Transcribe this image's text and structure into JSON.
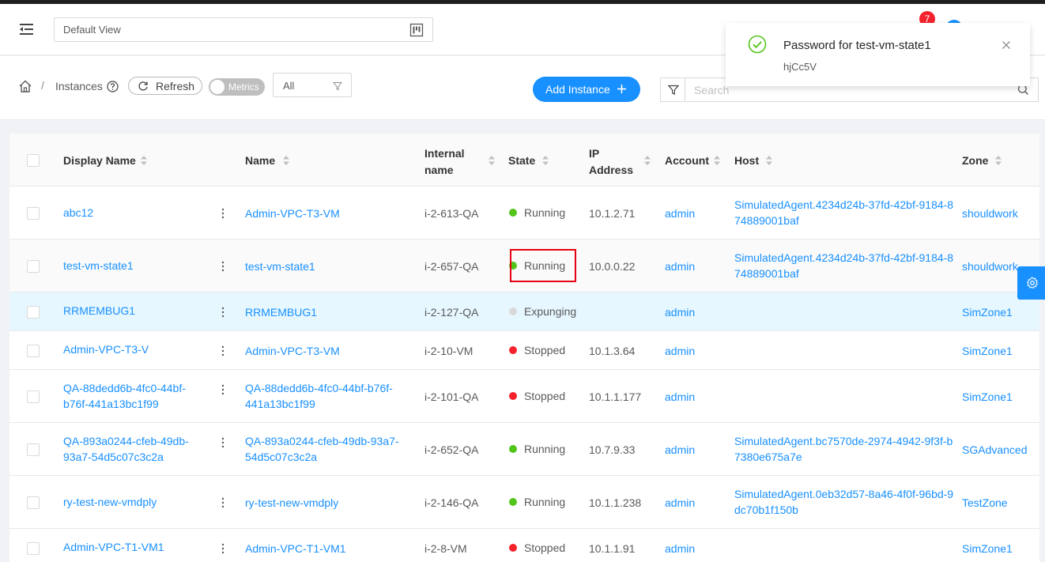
{
  "header": {
    "view_selector": "Default View",
    "notification_count": "7"
  },
  "breadcrumb": {
    "current": "Instances"
  },
  "toolbar": {
    "refresh_label": "Refresh",
    "metrics_label": "Metrics",
    "filter_value": "All",
    "add_label": "Add Instance",
    "search_placeholder": "Search"
  },
  "table": {
    "columns": [
      "Display Name",
      "Name",
      "Internal name",
      "State",
      "IP Address",
      "Account",
      "Host",
      "Zone"
    ],
    "rows": [
      {
        "display_name": "abc12",
        "name": "Admin-VPC-T3-VM",
        "internal": "i-2-613-QA",
        "state": "Running",
        "ip": "10.1.2.71",
        "account": "admin",
        "host": "SimulatedAgent.4234d24b-37fd-42bf-9184-874889001baf",
        "zone": "shouldwork"
      },
      {
        "display_name": "test-vm-state1",
        "name": "test-vm-state1",
        "internal": "i-2-657-QA",
        "state": "Running",
        "ip": "10.0.0.22",
        "account": "admin",
        "host": "SimulatedAgent.4234d24b-37fd-42bf-9184-874889001baf",
        "zone": "shouldwork"
      },
      {
        "display_name": "RRMEMBUG1",
        "name": "RRMEMBUG1",
        "internal": "i-2-127-QA",
        "state": "Expunging",
        "ip": "",
        "account": "admin",
        "host": "",
        "zone": "SimZone1"
      },
      {
        "display_name": "Admin-VPC-T3-V",
        "name": "Admin-VPC-T3-VM",
        "internal": "i-2-10-VM",
        "state": "Stopped",
        "ip": "10.1.3.64",
        "account": "admin",
        "host": "",
        "zone": "SimZone1"
      },
      {
        "display_name": "QA-88dedd6b-4fc0-44bf-b76f-441a13bc1f99",
        "name": "QA-88dedd6b-4fc0-44bf-b76f-441a13bc1f99",
        "internal": "i-2-101-QA",
        "state": "Stopped",
        "ip": "10.1.1.177",
        "account": "admin",
        "host": "",
        "zone": "SimZone1"
      },
      {
        "display_name": "QA-893a0244-cfeb-49db-93a7-54d5c07c3c2a",
        "name": "QA-893a0244-cfeb-49db-93a7-54d5c07c3c2a",
        "internal": "i-2-652-QA",
        "state": "Running",
        "ip": "10.7.9.33",
        "account": "admin",
        "host": "SimulatedAgent.bc7570de-2974-4942-9f3f-b7380e675a7e",
        "zone": "SGAdvanced"
      },
      {
        "display_name": "ry-test-new-vmdply",
        "name": "ry-test-new-vmdply",
        "internal": "i-2-146-QA",
        "state": "Running",
        "ip": "10.1.1.238",
        "account": "admin",
        "host": "SimulatedAgent.0eb32d57-8a46-4f0f-96bd-9dc70b1f150b",
        "zone": "TestZone"
      },
      {
        "display_name": "Admin-VPC-T1-VM1",
        "name": "Admin-VPC-T1-VM1",
        "internal": "i-2-8-VM",
        "state": "Stopped",
        "ip": "10.1.1.91",
        "account": "admin",
        "host": "",
        "zone": "SimZone1"
      }
    ]
  },
  "notification": {
    "title": "Password for test-vm-state1",
    "description": "hjCc5V"
  },
  "colors": {
    "accent": "#1890ff",
    "running": "#52c41a",
    "stopped": "#f5222d",
    "expunging": "#d9d9d9",
    "highlight_row": "#e6f7ff",
    "annotation_box": "#e60012"
  },
  "icons": [
    "menu-fold-icon",
    "layout-icon",
    "home-icon",
    "question-circle-icon",
    "reload-icon",
    "filter-icon",
    "plus-icon",
    "search-icon",
    "more-vertical-icon",
    "check-circle-icon",
    "close-icon",
    "setting-icon",
    "sort-icon"
  ]
}
